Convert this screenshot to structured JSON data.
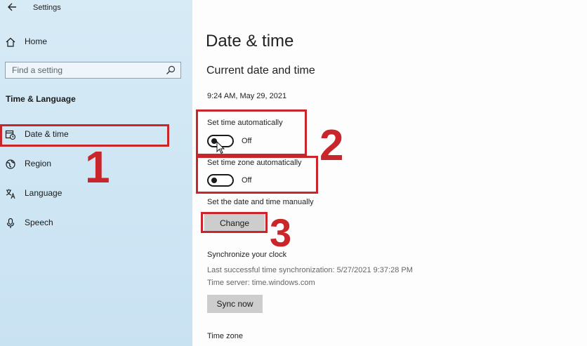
{
  "window": {
    "title": "Settings"
  },
  "sidebar": {
    "home_label": "Home",
    "search_placeholder": "Find a setting",
    "section_title": "Time & Language",
    "items": [
      {
        "label": "Date & time",
        "icon": "calendar-clock-icon"
      },
      {
        "label": "Region",
        "icon": "globe-icon"
      },
      {
        "label": "Language",
        "icon": "language-icon"
      },
      {
        "label": "Speech",
        "icon": "microphone-icon"
      }
    ]
  },
  "main": {
    "page_title": "Date & time",
    "section_title": "Current date and time",
    "current_datetime": "9:24 AM, May 29, 2021",
    "set_time_auto": {
      "label": "Set time automatically",
      "state": "Off"
    },
    "set_timezone_auto": {
      "label": "Set time zone automatically",
      "state": "Off"
    },
    "manual": {
      "label": "Set the date and time manually",
      "button": "Change"
    },
    "sync": {
      "title": "Synchronize your clock",
      "last_sync": "Last successful time synchronization: 5/27/2021 9:37:28 PM",
      "server": "Time server: time.windows.com",
      "button": "Sync now"
    },
    "timezone_label": "Time zone"
  },
  "annotations": {
    "step1": "1",
    "step2": "2",
    "step3": "3",
    "color": "#c8262b"
  }
}
